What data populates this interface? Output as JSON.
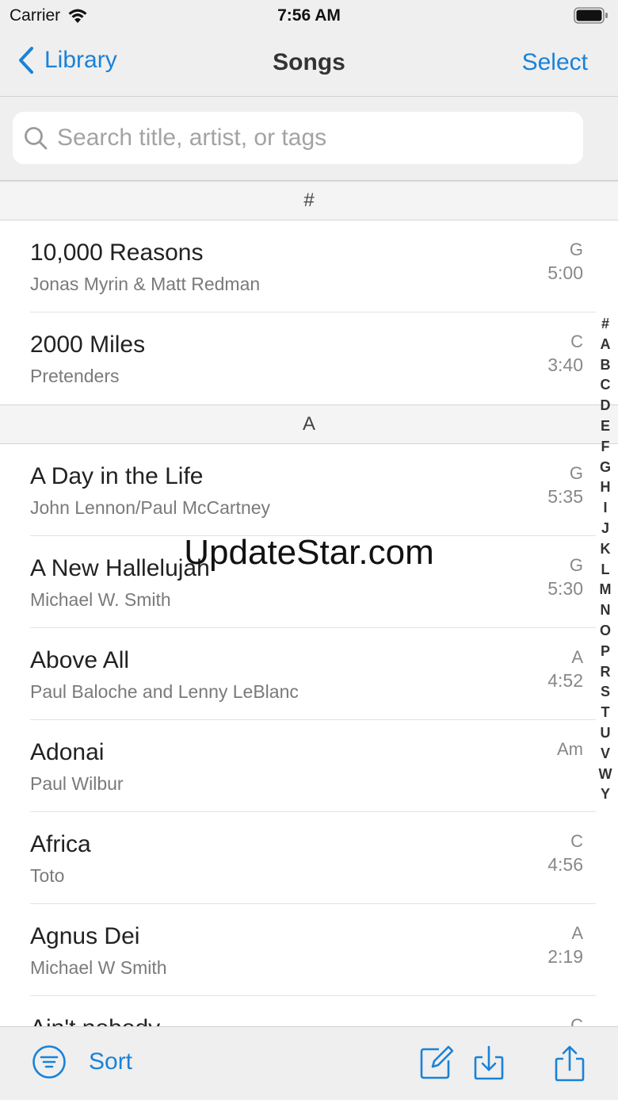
{
  "status": {
    "carrier": "Carrier",
    "time": "7:56 AM"
  },
  "nav": {
    "back_label": "Library",
    "title": "Songs",
    "select_label": "Select"
  },
  "search": {
    "placeholder": "Search title, artist, or tags",
    "value": ""
  },
  "sections": [
    {
      "header": "#",
      "songs": [
        {
          "title": "10,000 Reasons",
          "artist": "Jonas Myrin & Matt Redman",
          "key": "G",
          "duration": "5:00"
        },
        {
          "title": "2000 Miles",
          "artist": "Pretenders",
          "key": "C",
          "duration": "3:40"
        }
      ]
    },
    {
      "header": "A",
      "songs": [
        {
          "title": "A Day in the Life",
          "artist": "John Lennon/Paul McCartney",
          "key": "G",
          "duration": "5:35"
        },
        {
          "title": "A New Hallelujah",
          "artist": "Michael W. Smith",
          "key": "G",
          "duration": "5:30"
        },
        {
          "title": "Above All",
          "artist": "Paul Baloche and Lenny LeBlanc",
          "key": "A",
          "duration": "4:52"
        },
        {
          "title": "Adonai",
          "artist": "Paul Wilbur",
          "key": "Am",
          "duration": ""
        },
        {
          "title": "Africa",
          "artist": "Toto",
          "key": "C",
          "duration": "4:56"
        },
        {
          "title": "Agnus Dei",
          "artist": "Michael W Smith",
          "key": "A",
          "duration": "2:19"
        },
        {
          "title": "Ain't nobody",
          "artist": "",
          "key": "C",
          "duration": ""
        }
      ]
    }
  ],
  "index_letters": [
    "#",
    "A",
    "B",
    "C",
    "D",
    "E",
    "F",
    "G",
    "H",
    "I",
    "J",
    "K",
    "L",
    "M",
    "N",
    "O",
    "P",
    "R",
    "S",
    "T",
    "U",
    "V",
    "W",
    "Y"
  ],
  "watermark": "UpdateStar.com",
  "toolbar": {
    "sort_label": "Sort"
  },
  "colors": {
    "accent": "#1a82d8",
    "bar_bg": "#efefef"
  },
  "icons": {
    "back": "chevron-left-icon",
    "search": "search-icon",
    "sort": "sort-lines-icon",
    "edit": "compose-icon",
    "import": "download-icon",
    "share": "share-icon"
  }
}
